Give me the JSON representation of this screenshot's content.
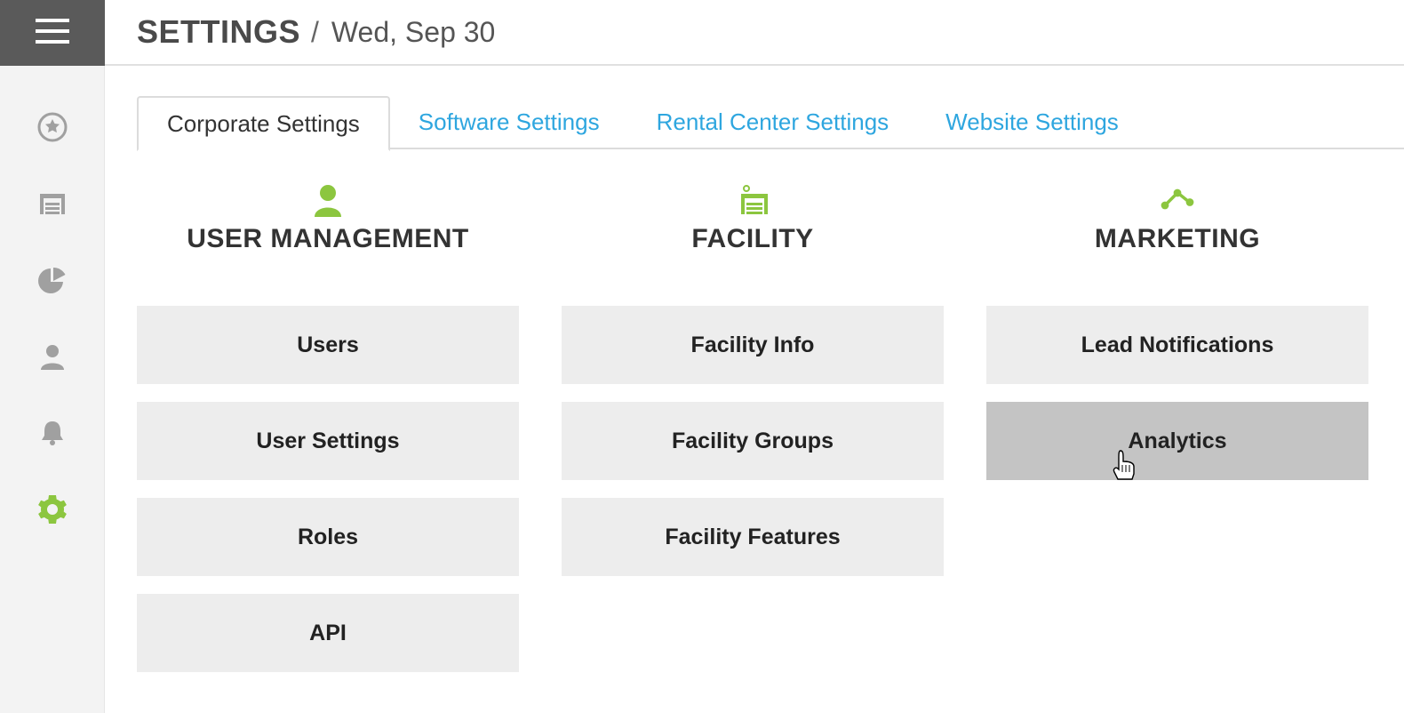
{
  "header": {
    "title": "SETTINGS",
    "separator": "/",
    "date": "Wed, Sep 30"
  },
  "sidebar": {
    "icons": [
      {
        "name": "star",
        "active": false
      },
      {
        "name": "garage",
        "active": false
      },
      {
        "name": "chart",
        "active": false
      },
      {
        "name": "user",
        "active": false
      },
      {
        "name": "bell",
        "active": false
      },
      {
        "name": "gear",
        "active": true
      }
    ]
  },
  "tabs": [
    {
      "label": "Corporate Settings",
      "active": true
    },
    {
      "label": "Software Settings",
      "active": false
    },
    {
      "label": "Rental Center Settings",
      "active": false
    },
    {
      "label": "Website Settings",
      "active": false
    }
  ],
  "sections": [
    {
      "icon": "user",
      "title": "USER MANAGEMENT",
      "items": [
        {
          "label": "Users",
          "hover": false
        },
        {
          "label": "User Settings",
          "hover": false
        },
        {
          "label": "Roles",
          "hover": false
        },
        {
          "label": "API",
          "hover": false
        }
      ]
    },
    {
      "icon": "facility",
      "title": "FACILITY",
      "items": [
        {
          "label": "Facility Info",
          "hover": false
        },
        {
          "label": "Facility Groups",
          "hover": false
        },
        {
          "label": "Facility Features",
          "hover": false
        }
      ]
    },
    {
      "icon": "marketing",
      "title": "MARKETING",
      "items": [
        {
          "label": "Lead Notifications",
          "hover": false
        },
        {
          "label": "Analytics",
          "hover": true
        }
      ]
    }
  ]
}
